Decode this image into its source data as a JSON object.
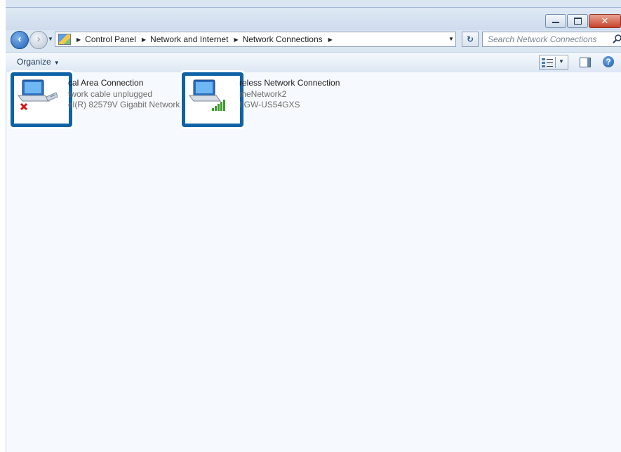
{
  "window": {
    "caption_buttons": {
      "minimize": "",
      "maximize": "",
      "close": "✕"
    }
  },
  "navigation": {
    "back_glyph": "‹",
    "forward_glyph": "›",
    "breadcrumbs": [
      "Control Panel",
      "Network and Internet",
      "Network Connections"
    ],
    "refresh_glyph": "↻",
    "search_placeholder": "Search Network Connections"
  },
  "toolbar": {
    "organize_label": "Organize",
    "help_glyph": "?"
  },
  "connections": [
    {
      "name": "cal Area Connection",
      "status": "twork cable unplugged",
      "device": "el(R) 82579V Gigabit Network C",
      "icon": "wired-network-disconnected-icon"
    },
    {
      "name": "reless Network Connection",
      "status": "meNetwork2",
      "device": "I GW-US54GXS",
      "icon": "wireless-network-icon"
    }
  ],
  "colors": {
    "highlight_border": "#0e63a6",
    "accent": "#1e56a8"
  }
}
